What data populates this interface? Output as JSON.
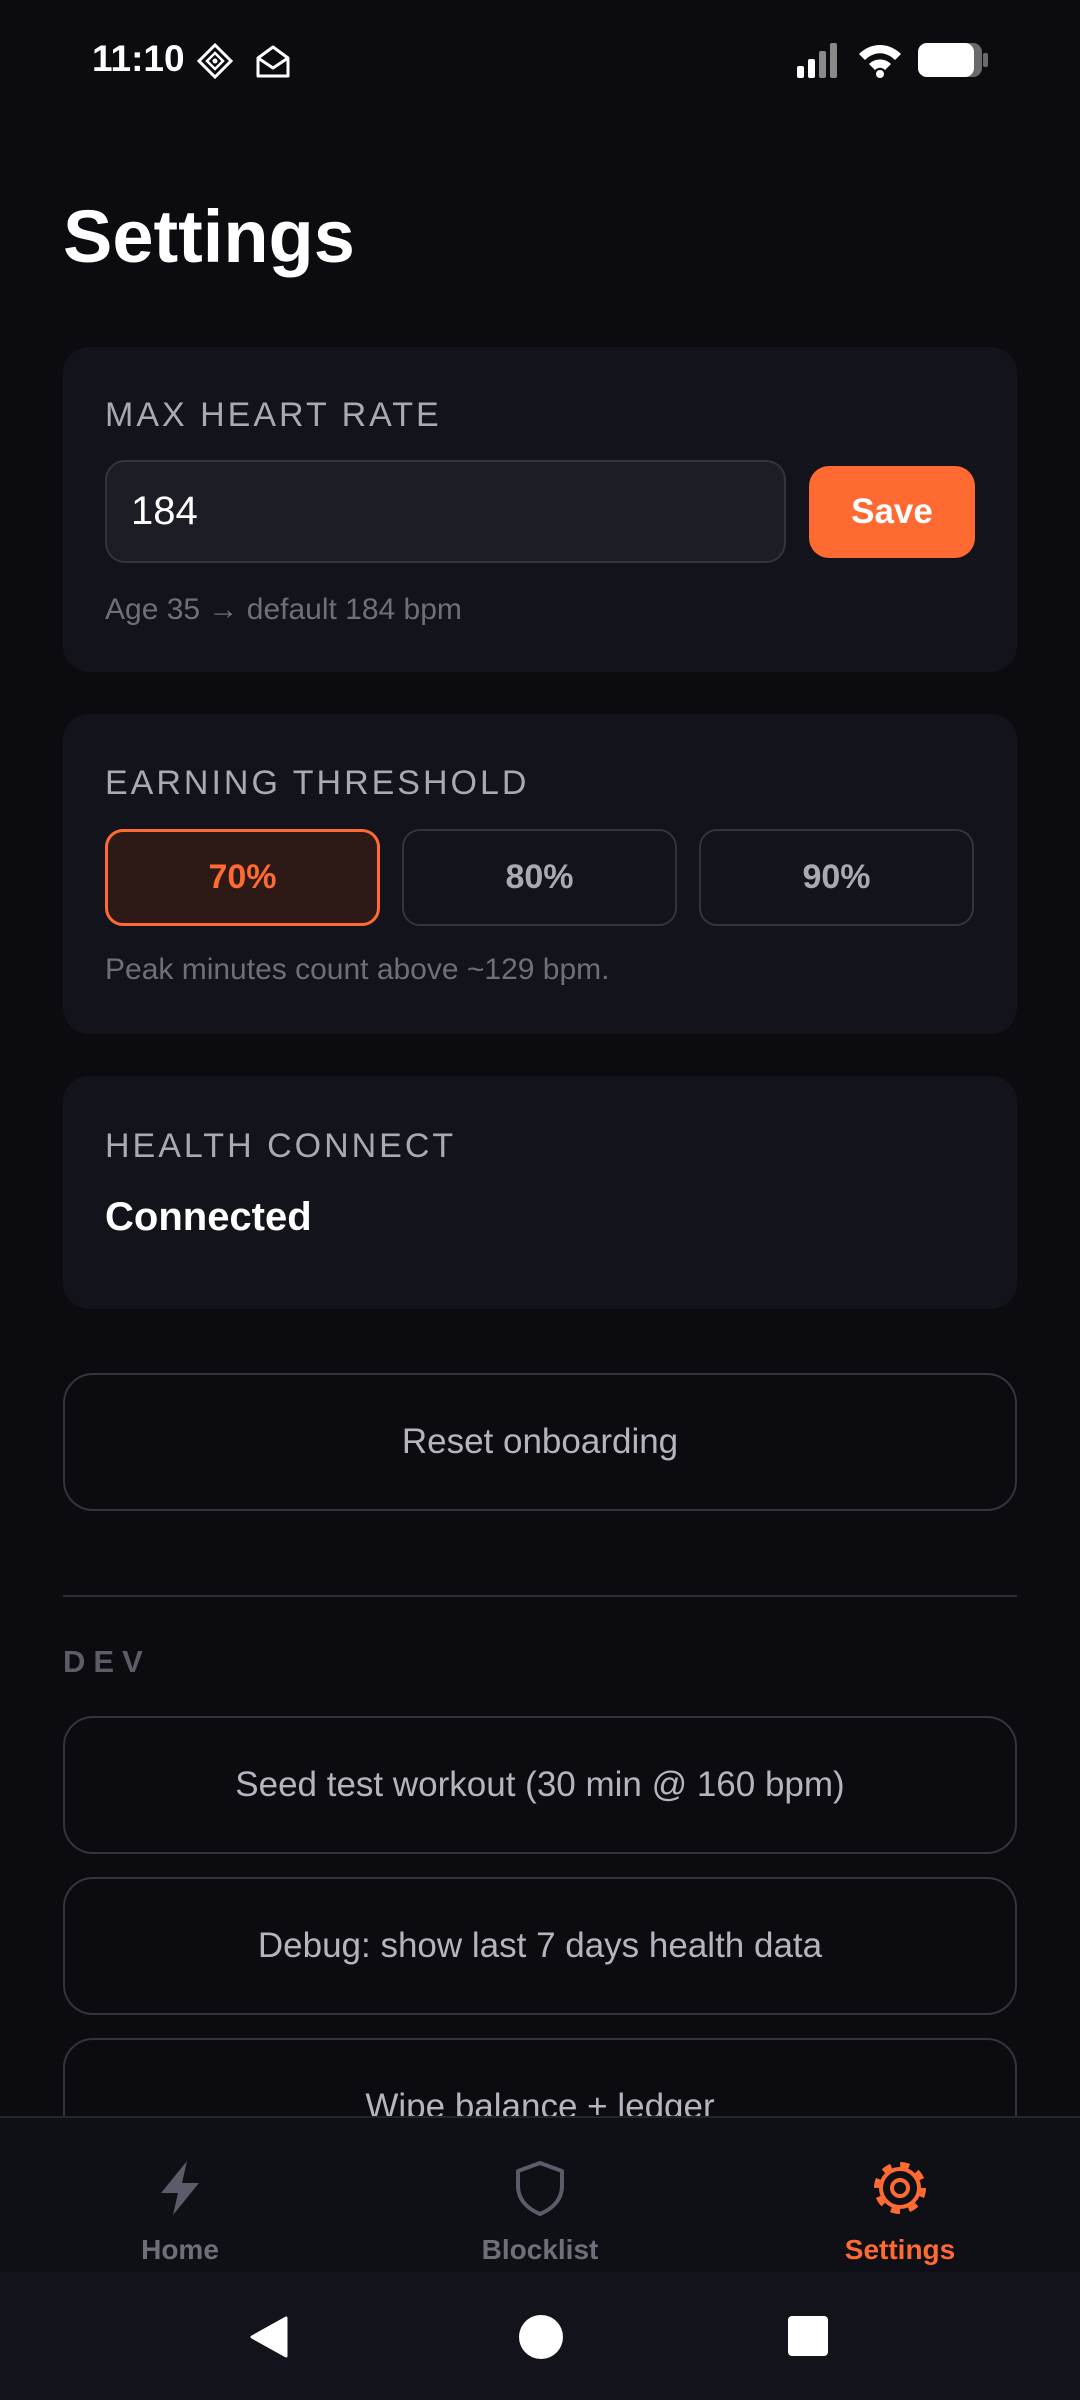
{
  "status_bar": {
    "time": "11:10",
    "icons_left": [
      "app-notification-icon",
      "mail-icon"
    ],
    "icons_right": [
      "signal-icon",
      "wifi-icon",
      "battery-icon"
    ]
  },
  "page": {
    "title": "Settings"
  },
  "max_heart_rate": {
    "label": "MAX HEART RATE",
    "input_value": "184",
    "save_label": "Save",
    "hint": "Age 35 → default 184 bpm"
  },
  "earning_threshold": {
    "label": "EARNING THRESHOLD",
    "options": [
      {
        "label": "70%",
        "selected": true
      },
      {
        "label": "80%",
        "selected": false
      },
      {
        "label": "90%",
        "selected": false
      }
    ],
    "hint": "Peak minutes count above ~129 bpm."
  },
  "health_connect": {
    "label": "HEALTH CONNECT",
    "status": "Connected"
  },
  "reset_onboarding_label": "Reset onboarding",
  "dev": {
    "section_label": "DEV",
    "buttons": [
      "Seed test workout (30 min @ 160 bpm)",
      "Debug: show last 7 days health data",
      "Wipe balance + ledger"
    ]
  },
  "bottom_nav": {
    "items": [
      {
        "label": "Home",
        "icon": "lightning-icon",
        "active": false
      },
      {
        "label": "Blocklist",
        "icon": "shield-icon",
        "active": false
      },
      {
        "label": "Settings",
        "icon": "gear-icon",
        "active": true
      }
    ]
  },
  "system_nav": {
    "buttons": [
      "back-icon",
      "home-icon",
      "recents-icon"
    ]
  },
  "colors": {
    "background": "#0b0b10",
    "card": "#13131b",
    "accent": "#ff6a33",
    "nav_inactive": "#6f6f7b"
  }
}
